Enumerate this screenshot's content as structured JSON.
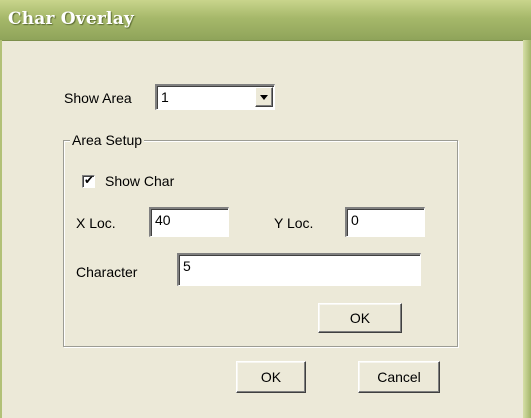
{
  "window": {
    "title": "Char Overlay"
  },
  "show_area": {
    "label": "Show Area",
    "selected": "1"
  },
  "area_setup": {
    "caption": "Area Setup",
    "show_char": {
      "label": "Show Char",
      "checked": true
    },
    "x_loc": {
      "label": "X Loc.",
      "value": "40"
    },
    "y_loc": {
      "label": "Y Loc.",
      "value": "0"
    },
    "character": {
      "label": "Character",
      "value": "5"
    },
    "ok_label": "OK"
  },
  "footer": {
    "ok_label": "OK",
    "cancel_label": "Cancel"
  },
  "colors": {
    "title_bar": "#a6b86a",
    "dialog_face": "#ece9d8",
    "title_text": "#ffffff"
  },
  "icons": {
    "dropdown": "chevron-down-icon",
    "checkmark": "checkmark-icon"
  }
}
